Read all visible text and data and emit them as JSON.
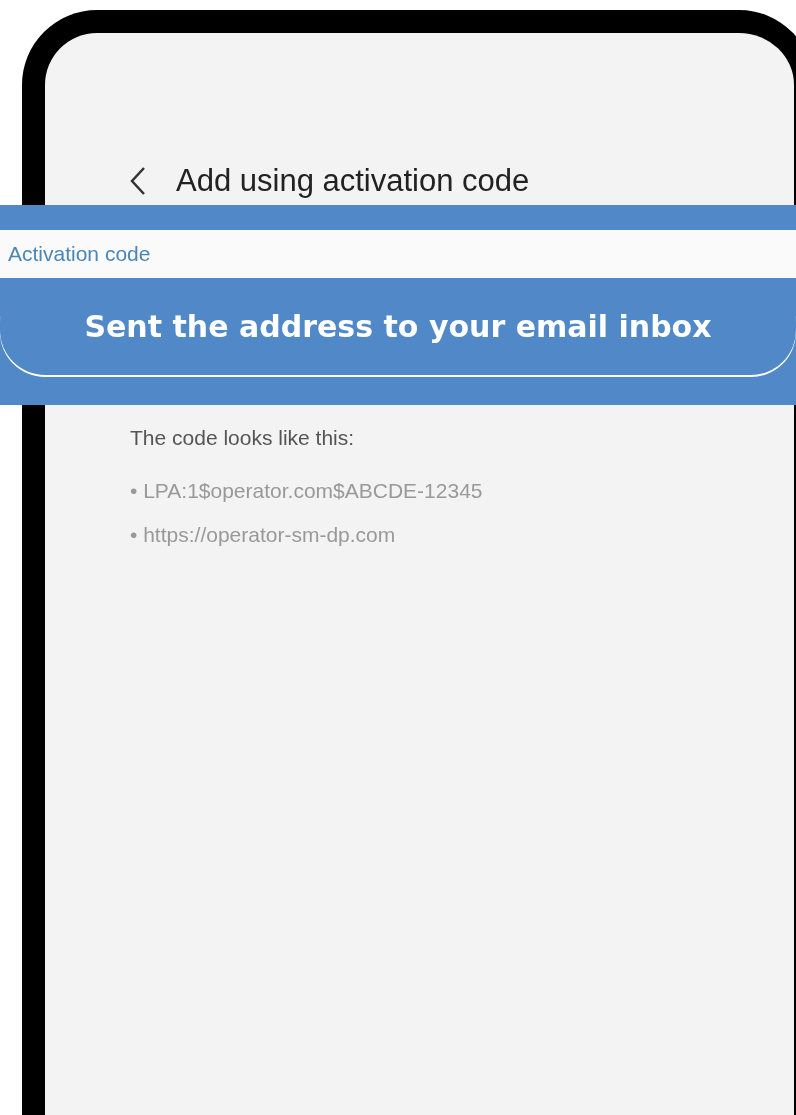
{
  "header": {
    "title": "Add using activation code"
  },
  "overlay": {
    "label": "Activation code",
    "message": "Sent the address to your email inbox"
  },
  "hint": {
    "intro": "The code looks like this:",
    "examples": [
      "• LPA:1$operator.com$ABCDE-12345",
      "• https://operator-sm-dp.com"
    ]
  }
}
